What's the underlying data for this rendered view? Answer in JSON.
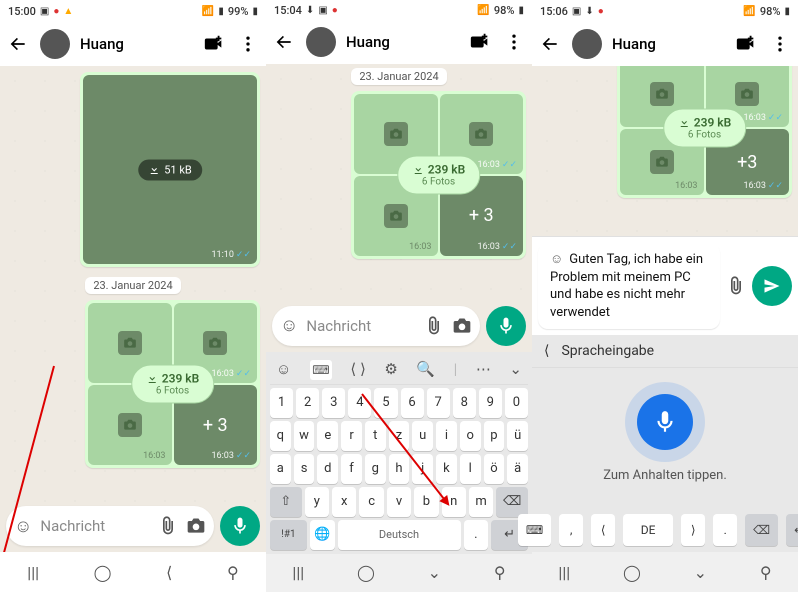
{
  "screen1": {
    "status": {
      "time": "15:00",
      "battery": "99%"
    },
    "contact_name": "Huang",
    "big_image": {
      "size": "51 kB",
      "time": "11:10"
    },
    "date_chip": "23. Januar 2024",
    "grid": {
      "size": "239 kB",
      "count": "6 Fotos",
      "more": "+ 3",
      "t1": "16:03",
      "t2": "16:03",
      "t3": "16:03"
    },
    "input_placeholder": "Nachricht"
  },
  "screen2": {
    "status": {
      "time": "15:04",
      "battery": "98%"
    },
    "contact_name": "Huang",
    "date_chip": "23. Januar 2024",
    "grid": {
      "size": "239 kB",
      "count": "6 Fotos",
      "more": "+ 3",
      "t1": "16:03",
      "t2": "16:03",
      "t3": "16:03"
    },
    "input_placeholder": "Nachricht",
    "keyboard": {
      "row_num": [
        "1",
        "2",
        "3",
        "4",
        "5",
        "6",
        "7",
        "8",
        "9",
        "0"
      ],
      "row1": [
        "q",
        "w",
        "e",
        "r",
        "t",
        "z",
        "u",
        "i",
        "o",
        "p",
        "ü"
      ],
      "row2": [
        "a",
        "s",
        "d",
        "f",
        "g",
        "h",
        "j",
        "k",
        "l",
        "ö",
        "ä"
      ],
      "row3_mid": [
        "y",
        "x",
        "c",
        "v",
        "b",
        "n",
        "m"
      ],
      "bottom": {
        "sym": "!#1",
        "space": "Deutsch",
        "dot": "."
      }
    }
  },
  "screen3": {
    "status": {
      "time": "15:06",
      "battery": "98%"
    },
    "contact_name": "Huang",
    "grid": {
      "size": "239 kB",
      "count": "6 Fotos",
      "more": "+3",
      "t1": "16:03",
      "t2": "16:03",
      "t3": "16:03"
    },
    "text_msg": "Guten Tag, ich habe ein Problem mit meinem PC und habe es nicht mehr verwendet",
    "voice": {
      "title": "Spracheingabe",
      "hint": "Zum Anhalten tippen.",
      "lang_short": "DE"
    }
  }
}
